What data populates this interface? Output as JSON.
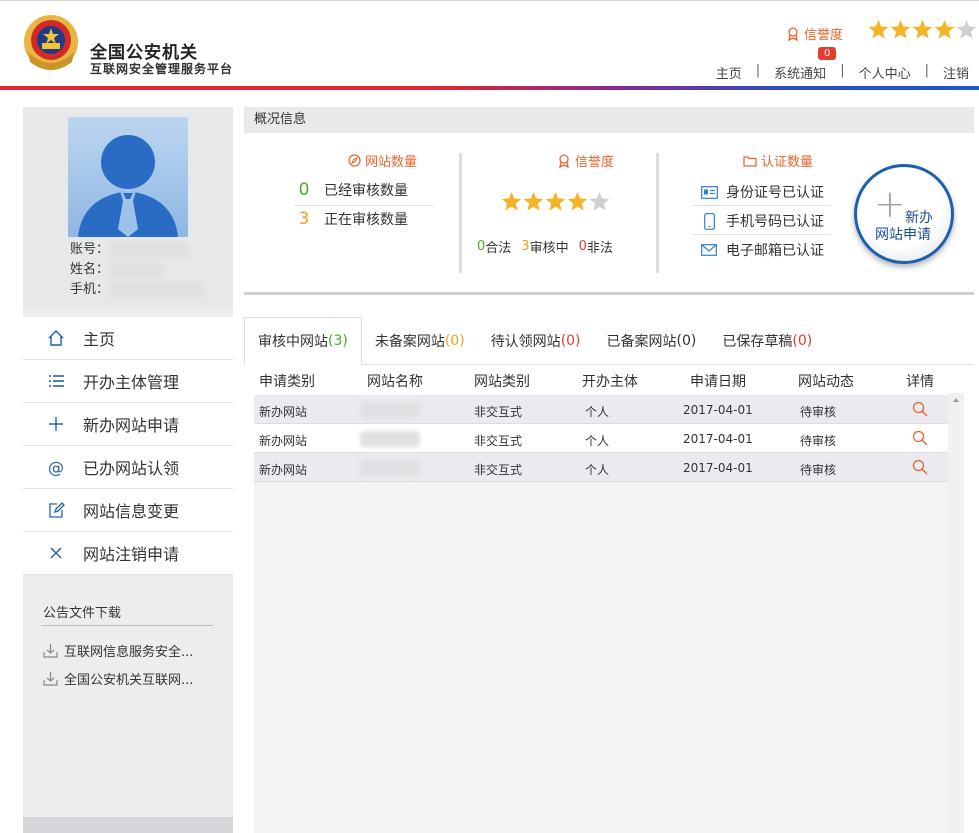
{
  "header": {
    "title": "全国公安机关",
    "subtitle": "互联网安全管理服务平台",
    "credit_label": "信誉度",
    "credit_stars": 4,
    "notification_count": "0",
    "nav": [
      "主页",
      "系统通知",
      "个人中心",
      "注销"
    ]
  },
  "profile": {
    "account_label": "账号：",
    "name_label": "姓名：",
    "phone_label": "手机："
  },
  "sidebar": {
    "items": [
      {
        "label": "主页",
        "icon": "home-icon"
      },
      {
        "label": "开办主体管理",
        "icon": "list-icon"
      },
      {
        "label": "新办网站申请",
        "icon": "plus-icon"
      },
      {
        "label": "已办网站认领",
        "icon": "at-icon"
      },
      {
        "label": "网站信息变更",
        "icon": "edit-icon"
      },
      {
        "label": "网站注销申请",
        "icon": "close-icon"
      }
    ],
    "notice_title": "公告文件下载",
    "notices": [
      "互联网信息服务安全...",
      "全国公安机关互联网..."
    ]
  },
  "summary": {
    "heading": "概况信息",
    "site_count_title": "网站数量",
    "reviewed_num": "0",
    "reviewed_label": "已经审核数量",
    "reviewing_num": "3",
    "reviewing_label": "正在审核数量",
    "credit_title": "信誉度",
    "credit_stars": 4,
    "legal_num": "0",
    "legal_label": "合法",
    "pending_num": "3",
    "pending_label": "审核中",
    "illegal_num": "0",
    "illegal_label": "非法",
    "cert_title": "认证数量",
    "certs": [
      "身份证号已认证",
      "手机号码已认证",
      "电子邮箱已认证"
    ],
    "new_btn_line1": "新办",
    "new_btn_line2": "网站申请"
  },
  "tabs": [
    {
      "label": "审核中网站",
      "count": "(3)",
      "count_color": "#4caa2f"
    },
    {
      "label": "未备案网站",
      "count": "(0)",
      "count_color": "#f0a020"
    },
    {
      "label": "待认领网站",
      "count": "(0)",
      "count_color": "#e23c2f"
    },
    {
      "label": "已备案网站",
      "count": "(0)",
      "count_color": "#333333"
    },
    {
      "label": "已保存草稿",
      "count": "(0)",
      "count_color": "#e23c2f"
    }
  ],
  "table": {
    "columns": [
      "申请类别",
      "网站名称",
      "网站类别",
      "开办主体",
      "申请日期",
      "网站动态",
      "详情"
    ],
    "rows": [
      [
        "新办网站",
        "",
        "非交互式",
        "个人",
        "2017-04-01",
        "待审核"
      ],
      [
        "新办网站",
        "",
        "非交互式",
        "个人",
        "2017-04-01",
        "待审核"
      ],
      [
        "新办网站",
        "",
        "非交互式",
        "个人",
        "2017-04-01",
        "待审核"
      ]
    ]
  },
  "colors": {
    "accent_orange": "#e8632c",
    "brand_blue": "#1c5fae",
    "star_gold": "#f5b428",
    "star_grey": "#d0d0d0"
  }
}
